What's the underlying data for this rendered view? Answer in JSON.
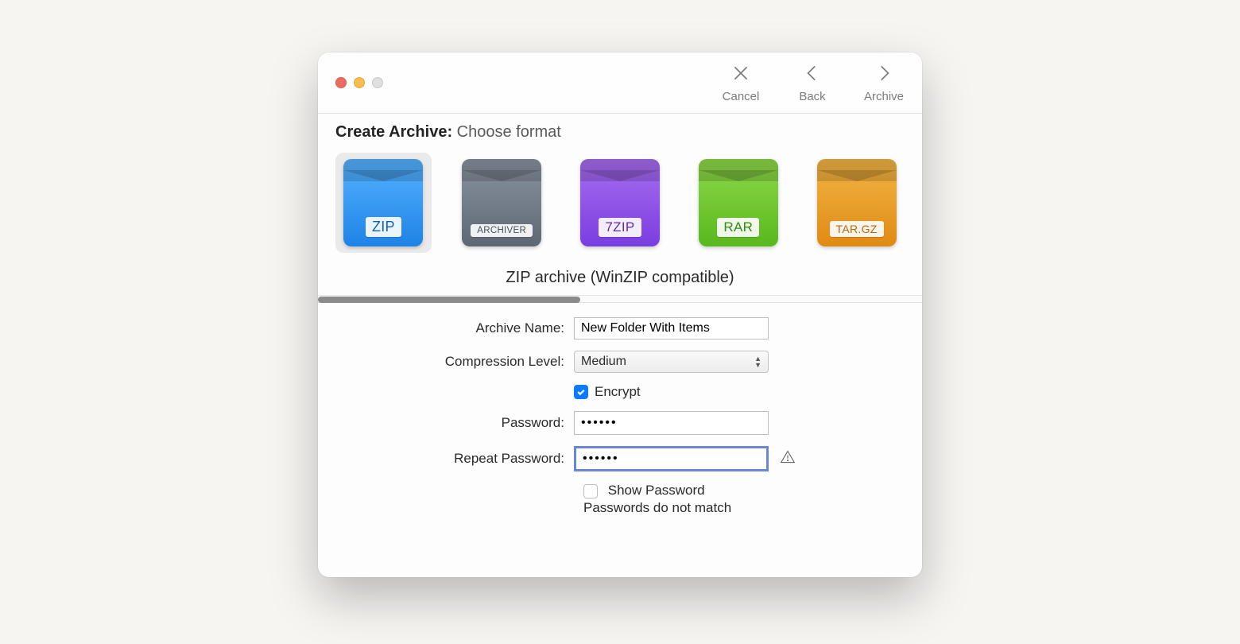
{
  "titlebar": {
    "cancel": "Cancel",
    "back": "Back",
    "archive": "Archive"
  },
  "header": {
    "title_strong": "Create Archive:",
    "title_light": "Choose format"
  },
  "formats": {
    "items": [
      {
        "tag": "ZIP",
        "selected": true
      },
      {
        "tag": "ARCHIVER",
        "selected": false
      },
      {
        "tag": "7ZIP",
        "selected": false
      },
      {
        "tag": "RAR",
        "selected": false
      },
      {
        "tag": "TAR.GZ",
        "selected": false
      }
    ],
    "description": "ZIP archive (WinZIP compatible)"
  },
  "form": {
    "archive_name_label": "Archive Name:",
    "archive_name_value": "New Folder With Items",
    "compression_label": "Compression Level:",
    "compression_value": "Medium",
    "encrypt_label": "Encrypt",
    "encrypt_checked": true,
    "password_label": "Password:",
    "password_value": "••••••",
    "repeat_password_label": "Repeat Password:",
    "repeat_password_value": "••••••",
    "show_password_label": "Show Password",
    "show_password_checked": false,
    "error_text": "Passwords do not match"
  }
}
